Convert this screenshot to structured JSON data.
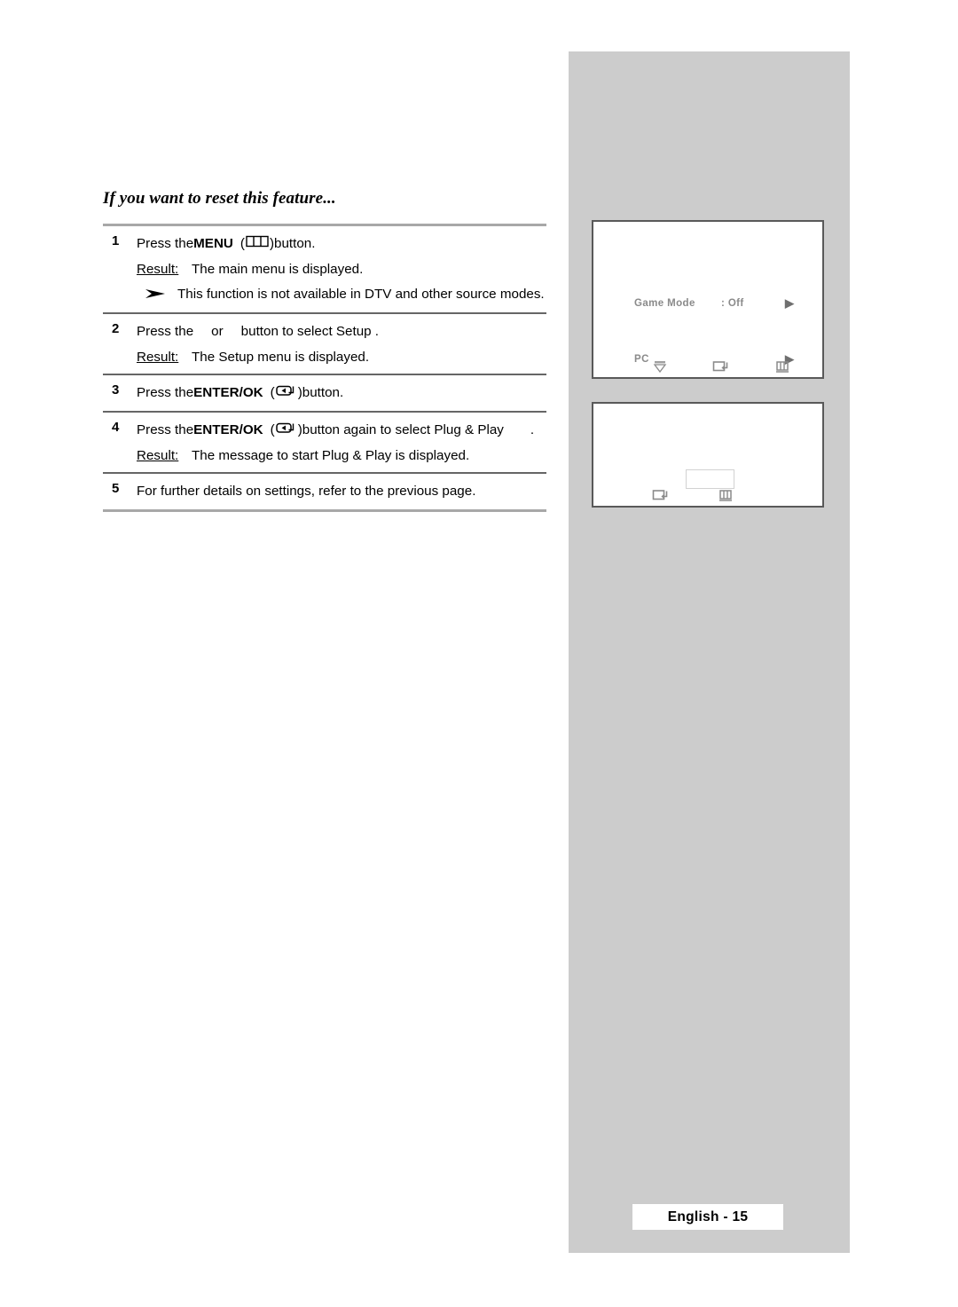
{
  "document": {
    "heading": "If you want to reset this feature...",
    "page_tag": "English - 15"
  },
  "steps": [
    {
      "number": "1",
      "lines": [
        {
          "pre": "Press the ",
          "bold": "MENU",
          "paren_open": "(",
          "icon": "menu-button-icon",
          "paren_close": ")",
          "post": " button."
        }
      ],
      "result": {
        "label": "Result:",
        "text": "The main menu is displayed."
      },
      "note": {
        "bullet": "note-arrow-icon",
        "text": "This function is not available in DTV and other source modes."
      }
    },
    {
      "number": "2",
      "lines": [
        {
          "pre": "Press the ",
          "mid": "or",
          "post": "button to select Setup ."
        }
      ],
      "result": {
        "label": "Result:",
        "text": "The Setup  menu is displayed."
      }
    },
    {
      "number": "3",
      "lines": [
        {
          "pre": "Press the ",
          "bold": "ENTER/OK",
          "paren_open": "(",
          "icon": "enter-ok-button-icon",
          "paren_close": ")",
          "post": " button."
        }
      ]
    },
    {
      "number": "4",
      "lines": [
        {
          "pre": "Press the ",
          "bold": "ENTER/OK",
          "paren_open": "(",
          "icon": "enter-ok-button-icon",
          "paren_close": ")",
          "post": " button again to select Plug & Play",
          "tail": "."
        }
      ],
      "result": {
        "label": "Result:",
        "text": "The message to start Plug & Play is displayed."
      }
    },
    {
      "number": "5",
      "lines": [
        {
          "pre": "For further details on settings, refer to the previous page."
        }
      ]
    }
  ],
  "osd": {
    "box1": {
      "rows": [
        {
          "label": "Game Mode",
          "value": ": Off",
          "arrow": "▶"
        },
        {
          "label": "PC",
          "value": "",
          "arrow": "▶"
        }
      ],
      "icons": [
        "move-down-icon",
        "enter-icon",
        "return-menu-icon"
      ]
    },
    "box2": {
      "icons": [
        "enter-icon",
        "return-menu-icon"
      ]
    }
  },
  "colors": {
    "sidebar": "#cccccc",
    "osd_border": "#595959",
    "osd_text": "#8a8a8a",
    "rule": "#a8a8a8"
  }
}
